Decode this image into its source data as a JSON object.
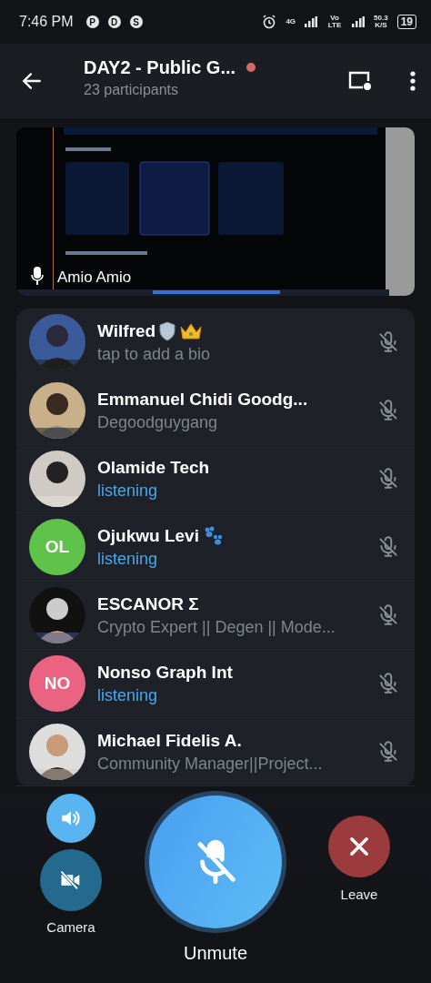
{
  "status_bar": {
    "time": "7:46 PM",
    "notification_icons": [
      "P",
      "D",
      "S"
    ],
    "network_1": "4G",
    "network_2": "Vo LTE",
    "speed": "50.3",
    "speed_unit": "K/S",
    "battery": "19"
  },
  "header": {
    "title": "DAY2 - Public G...",
    "recording": true,
    "subtitle": "23 participants"
  },
  "video": {
    "kind": "picture",
    "speaker": "Amio Amio"
  },
  "participants": [
    {
      "name": "Wilfred",
      "badges": [
        {
          "kind": "shield"
        },
        {
          "kind": "crown"
        }
      ],
      "subtitle": "tap to add a bio",
      "listening": false,
      "avatar": {
        "kind": "picture"
      }
    },
    {
      "name": "Emmanuel Chidi Goodg...",
      "subtitle": "Degoodguygang",
      "listening": false,
      "avatar": {
        "kind": "picture"
      }
    },
    {
      "name": "Olamide Tech",
      "subtitle": "listening",
      "listening": true,
      "avatar": {
        "kind": "picture"
      }
    },
    {
      "name": "Ojukwu Levi",
      "badges": [
        {
          "kind": "paw"
        }
      ],
      "subtitle": "listening",
      "listening": true,
      "avatar": {
        "kind": "initials",
        "initials": "OL",
        "color": "#5fc34b"
      }
    },
    {
      "name": "ESCANOR Σ",
      "subtitle": "Crypto Expert || Degen || Mode...",
      "listening": false,
      "avatar": {
        "kind": "picture"
      }
    },
    {
      "name": "Nonso Graph Int",
      "subtitle": "listening",
      "listening": true,
      "avatar": {
        "kind": "initials",
        "initials": "NO",
        "color": "#ea6482"
      }
    },
    {
      "name": "Michael Fidelis A.",
      "subtitle": "Community Manager||Project...",
      "listening": false,
      "avatar": {
        "kind": "picture"
      }
    }
  ],
  "controls": {
    "camera_label": "Camera",
    "unmute_label": "Unmute",
    "leave_label": "Leave"
  }
}
